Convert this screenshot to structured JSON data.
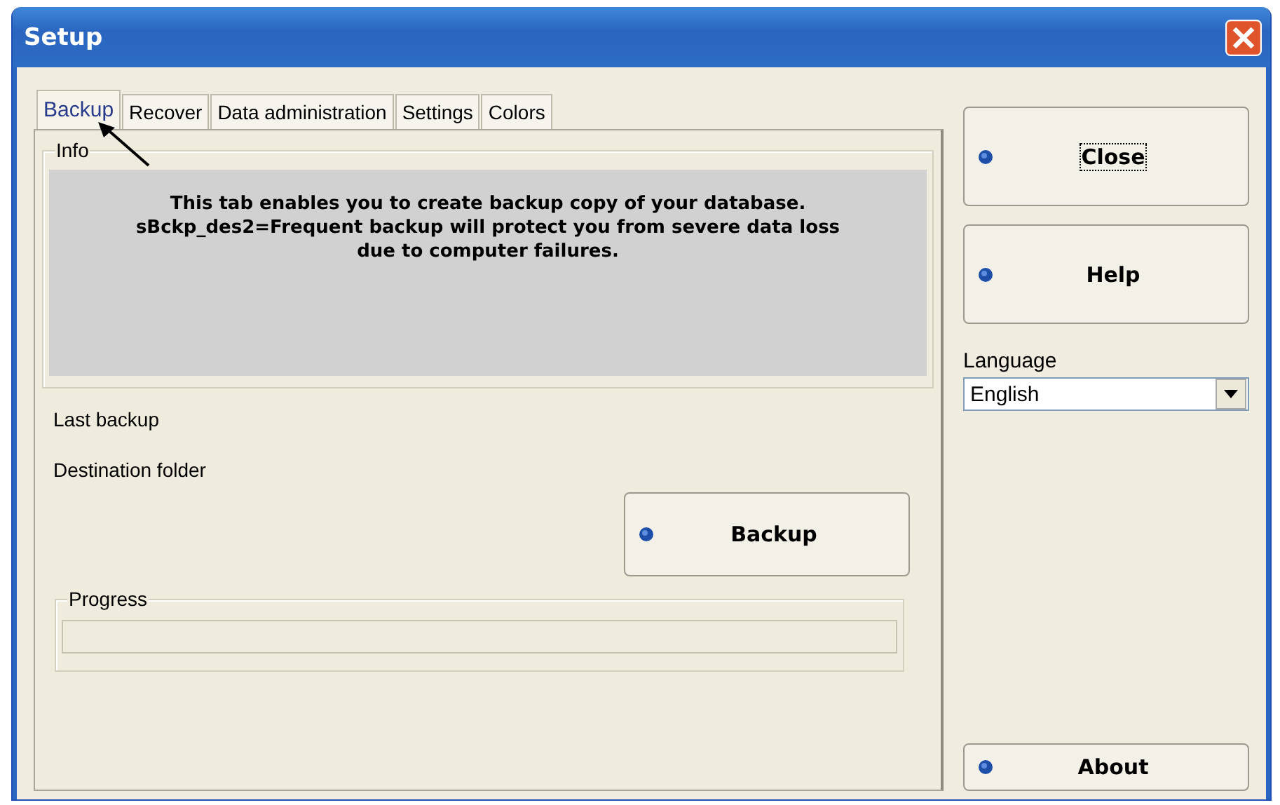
{
  "window": {
    "title": "Setup"
  },
  "tabs": [
    {
      "label": "Backup",
      "selected": true
    },
    {
      "label": "Recover",
      "selected": false
    },
    {
      "label": "Data administration",
      "selected": false
    },
    {
      "label": "Settings",
      "selected": false
    },
    {
      "label": "Colors",
      "selected": false
    }
  ],
  "info": {
    "title": "Info",
    "lines": [
      "This tab enables you to create backup copy of your database.",
      "sBckp_des2=Frequent backup will protect you from severe data loss",
      "due to computer failures."
    ]
  },
  "fields": [
    "Last backup",
    "Destination folder"
  ],
  "backup_button": {
    "label": "Backup",
    "focused": false
  },
  "progress": {
    "title": "Progress",
    "level": 0
  },
  "side_buttons": [
    {
      "label": "Close",
      "focused": true
    },
    {
      "label": "Help",
      "focused": false
    }
  ],
  "language": {
    "label": "Language",
    "value": "English"
  },
  "about_button": {
    "label": "About",
    "focused": false
  }
}
